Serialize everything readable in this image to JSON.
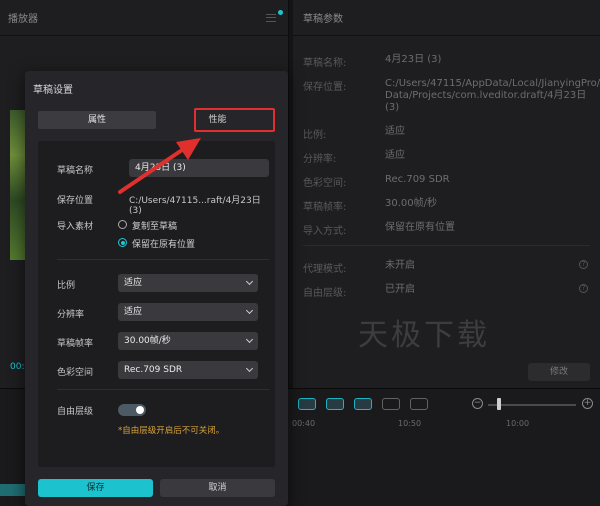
{
  "player": {
    "title": "播放器",
    "time": "00:0"
  },
  "params": {
    "title": "草稿参数",
    "rows": [
      {
        "label": "草稿名称:",
        "value": "4月23日 (3)"
      },
      {
        "label": "保存位置:",
        "value": "C:/Users/47115/AppData/Local/JianyingPro/User Data/Projects/com.lveditor.draft/4月23日 (3)"
      },
      {
        "label": "比例:",
        "value": "适应"
      },
      {
        "label": "分辨率:",
        "value": "适应"
      },
      {
        "label": "色彩空间:",
        "value": "Rec.709 SDR"
      },
      {
        "label": "草稿帧率:",
        "value": "30.00帧/秒"
      },
      {
        "label": "导入方式:",
        "value": "保留在原有位置"
      },
      {
        "label": "代理模式:",
        "value": "未开启"
      },
      {
        "label": "自由层级:",
        "value": "已开启"
      }
    ],
    "modify_label": "修改",
    "watermark": "天极下载"
  },
  "timeline": {
    "times": [
      "00:40",
      "10:50",
      "10:00"
    ]
  },
  "dialog": {
    "title": "草稿设置",
    "tab_attr": "属性",
    "tab_perf": "性能",
    "name_label": "草稿名称",
    "name_value": "4月23日 (3)",
    "location_label": "保存位置",
    "location_value": "C:/Users/47115...raft/4月23日 (3)",
    "import_label": "导入素材",
    "import_opt_copy": "复制至草稿",
    "import_opt_keep": "保留在原有位置",
    "ratio_label": "比例",
    "ratio_value": "适应",
    "resolution_label": "分辨率",
    "resolution_value": "适应",
    "framerate_label": "草稿帧率",
    "framerate_value": "30.00帧/秒",
    "colorspace_label": "色彩空间",
    "colorspace_value": "Rec.709 SDR",
    "freelayer_label": "自由层级",
    "freelayer_note": "*自由层级开启后不可关闭。",
    "save_label": "保存",
    "cancel_label": "取消"
  },
  "colors": {
    "accent": "#1cc7d3",
    "highlight": "#e0302e",
    "warning": "#d7a23a"
  }
}
